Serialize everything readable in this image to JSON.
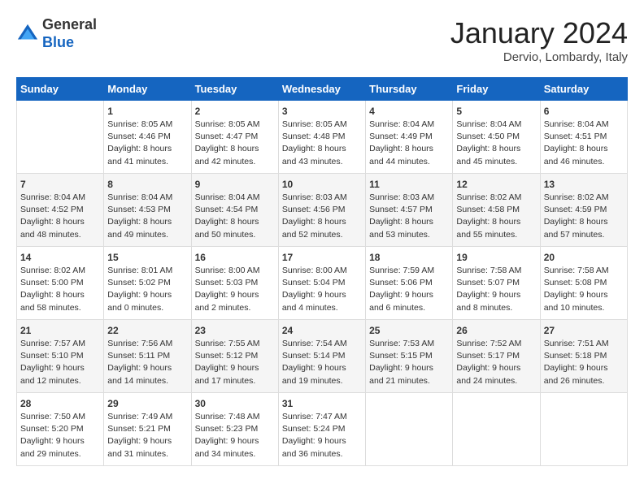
{
  "header": {
    "logo_general": "General",
    "logo_blue": "Blue",
    "month_title": "January 2024",
    "subtitle": "Dervio, Lombardy, Italy"
  },
  "days_of_week": [
    "Sunday",
    "Monday",
    "Tuesday",
    "Wednesday",
    "Thursday",
    "Friday",
    "Saturday"
  ],
  "weeks": [
    [
      {
        "day": "",
        "sunrise": "",
        "sunset": "",
        "daylight": ""
      },
      {
        "day": "1",
        "sunrise": "Sunrise: 8:05 AM",
        "sunset": "Sunset: 4:46 PM",
        "daylight": "Daylight: 8 hours and 41 minutes."
      },
      {
        "day": "2",
        "sunrise": "Sunrise: 8:05 AM",
        "sunset": "Sunset: 4:47 PM",
        "daylight": "Daylight: 8 hours and 42 minutes."
      },
      {
        "day": "3",
        "sunrise": "Sunrise: 8:05 AM",
        "sunset": "Sunset: 4:48 PM",
        "daylight": "Daylight: 8 hours and 43 minutes."
      },
      {
        "day": "4",
        "sunrise": "Sunrise: 8:04 AM",
        "sunset": "Sunset: 4:49 PM",
        "daylight": "Daylight: 8 hours and 44 minutes."
      },
      {
        "day": "5",
        "sunrise": "Sunrise: 8:04 AM",
        "sunset": "Sunset: 4:50 PM",
        "daylight": "Daylight: 8 hours and 45 minutes."
      },
      {
        "day": "6",
        "sunrise": "Sunrise: 8:04 AM",
        "sunset": "Sunset: 4:51 PM",
        "daylight": "Daylight: 8 hours and 46 minutes."
      }
    ],
    [
      {
        "day": "7",
        "sunrise": "Sunrise: 8:04 AM",
        "sunset": "Sunset: 4:52 PM",
        "daylight": "Daylight: 8 hours and 48 minutes."
      },
      {
        "day": "8",
        "sunrise": "Sunrise: 8:04 AM",
        "sunset": "Sunset: 4:53 PM",
        "daylight": "Daylight: 8 hours and 49 minutes."
      },
      {
        "day": "9",
        "sunrise": "Sunrise: 8:04 AM",
        "sunset": "Sunset: 4:54 PM",
        "daylight": "Daylight: 8 hours and 50 minutes."
      },
      {
        "day": "10",
        "sunrise": "Sunrise: 8:03 AM",
        "sunset": "Sunset: 4:56 PM",
        "daylight": "Daylight: 8 hours and 52 minutes."
      },
      {
        "day": "11",
        "sunrise": "Sunrise: 8:03 AM",
        "sunset": "Sunset: 4:57 PM",
        "daylight": "Daylight: 8 hours and 53 minutes."
      },
      {
        "day": "12",
        "sunrise": "Sunrise: 8:02 AM",
        "sunset": "Sunset: 4:58 PM",
        "daylight": "Daylight: 8 hours and 55 minutes."
      },
      {
        "day": "13",
        "sunrise": "Sunrise: 8:02 AM",
        "sunset": "Sunset: 4:59 PM",
        "daylight": "Daylight: 8 hours and 57 minutes."
      }
    ],
    [
      {
        "day": "14",
        "sunrise": "Sunrise: 8:02 AM",
        "sunset": "Sunset: 5:00 PM",
        "daylight": "Daylight: 8 hours and 58 minutes."
      },
      {
        "day": "15",
        "sunrise": "Sunrise: 8:01 AM",
        "sunset": "Sunset: 5:02 PM",
        "daylight": "Daylight: 9 hours and 0 minutes."
      },
      {
        "day": "16",
        "sunrise": "Sunrise: 8:00 AM",
        "sunset": "Sunset: 5:03 PM",
        "daylight": "Daylight: 9 hours and 2 minutes."
      },
      {
        "day": "17",
        "sunrise": "Sunrise: 8:00 AM",
        "sunset": "Sunset: 5:04 PM",
        "daylight": "Daylight: 9 hours and 4 minutes."
      },
      {
        "day": "18",
        "sunrise": "Sunrise: 7:59 AM",
        "sunset": "Sunset: 5:06 PM",
        "daylight": "Daylight: 9 hours and 6 minutes."
      },
      {
        "day": "19",
        "sunrise": "Sunrise: 7:58 AM",
        "sunset": "Sunset: 5:07 PM",
        "daylight": "Daylight: 9 hours and 8 minutes."
      },
      {
        "day": "20",
        "sunrise": "Sunrise: 7:58 AM",
        "sunset": "Sunset: 5:08 PM",
        "daylight": "Daylight: 9 hours and 10 minutes."
      }
    ],
    [
      {
        "day": "21",
        "sunrise": "Sunrise: 7:57 AM",
        "sunset": "Sunset: 5:10 PM",
        "daylight": "Daylight: 9 hours and 12 minutes."
      },
      {
        "day": "22",
        "sunrise": "Sunrise: 7:56 AM",
        "sunset": "Sunset: 5:11 PM",
        "daylight": "Daylight: 9 hours and 14 minutes."
      },
      {
        "day": "23",
        "sunrise": "Sunrise: 7:55 AM",
        "sunset": "Sunset: 5:12 PM",
        "daylight": "Daylight: 9 hours and 17 minutes."
      },
      {
        "day": "24",
        "sunrise": "Sunrise: 7:54 AM",
        "sunset": "Sunset: 5:14 PM",
        "daylight": "Daylight: 9 hours and 19 minutes."
      },
      {
        "day": "25",
        "sunrise": "Sunrise: 7:53 AM",
        "sunset": "Sunset: 5:15 PM",
        "daylight": "Daylight: 9 hours and 21 minutes."
      },
      {
        "day": "26",
        "sunrise": "Sunrise: 7:52 AM",
        "sunset": "Sunset: 5:17 PM",
        "daylight": "Daylight: 9 hours and 24 minutes."
      },
      {
        "day": "27",
        "sunrise": "Sunrise: 7:51 AM",
        "sunset": "Sunset: 5:18 PM",
        "daylight": "Daylight: 9 hours and 26 minutes."
      }
    ],
    [
      {
        "day": "28",
        "sunrise": "Sunrise: 7:50 AM",
        "sunset": "Sunset: 5:20 PM",
        "daylight": "Daylight: 9 hours and 29 minutes."
      },
      {
        "day": "29",
        "sunrise": "Sunrise: 7:49 AM",
        "sunset": "Sunset: 5:21 PM",
        "daylight": "Daylight: 9 hours and 31 minutes."
      },
      {
        "day": "30",
        "sunrise": "Sunrise: 7:48 AM",
        "sunset": "Sunset: 5:23 PM",
        "daylight": "Daylight: 9 hours and 34 minutes."
      },
      {
        "day": "31",
        "sunrise": "Sunrise: 7:47 AM",
        "sunset": "Sunset: 5:24 PM",
        "daylight": "Daylight: 9 hours and 36 minutes."
      },
      {
        "day": "",
        "sunrise": "",
        "sunset": "",
        "daylight": ""
      },
      {
        "day": "",
        "sunrise": "",
        "sunset": "",
        "daylight": ""
      },
      {
        "day": "",
        "sunrise": "",
        "sunset": "",
        "daylight": ""
      }
    ]
  ]
}
